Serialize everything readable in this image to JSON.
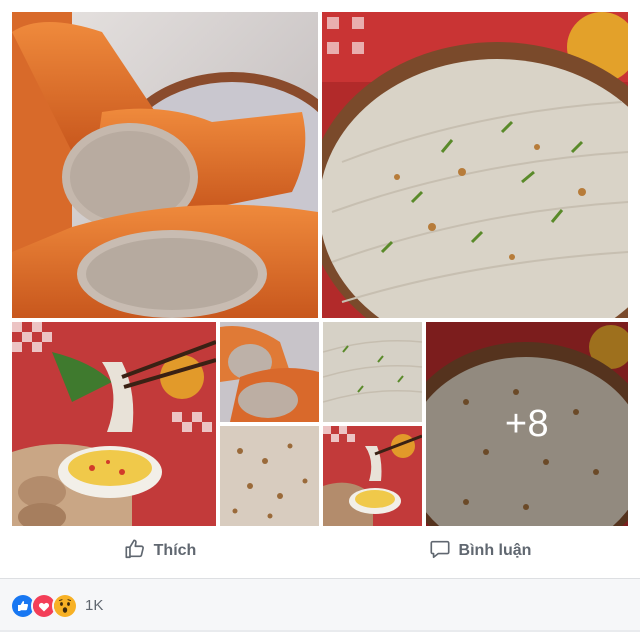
{
  "photos": [
    {
      "id": "p1",
      "subject": "fried-sausage-photo"
    },
    {
      "id": "p2",
      "subject": "rice-rolls-photo"
    },
    {
      "id": "p3",
      "subject": "dipping-rice-roll-photo"
    },
    {
      "id": "p4",
      "subject": "fried-sausage-thumb"
    },
    {
      "id": "p5",
      "subject": "rice-rolls-thumb"
    },
    {
      "id": "p6",
      "subject": "rice-rolls-fried-shallot-thumb"
    },
    {
      "id": "p7",
      "subject": "dipping-rice-roll-thumb"
    },
    {
      "id": "p8",
      "subject": "rice-rolls-more-photo"
    }
  ],
  "more_photos": "+8",
  "actions": {
    "like_label": "Thích",
    "comment_label": "Bình luận"
  },
  "reactions": {
    "icons": [
      "like-icon",
      "love-icon",
      "wow-icon"
    ],
    "count": "1K"
  },
  "colors": {
    "action_text": "#606770",
    "like_blue": "#1877f2",
    "love_red": "#f33e58",
    "wow_yellow": "#f7b125",
    "footer_bg": "#f6f7f9"
  }
}
